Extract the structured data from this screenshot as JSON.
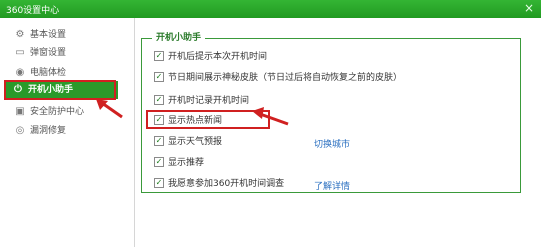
{
  "window": {
    "title": "360设置中心",
    "close_glyph": "×"
  },
  "sidebar": {
    "items": [
      {
        "label": "基本设置",
        "icon": "gear-icon",
        "glyph": "⚙"
      },
      {
        "label": "弹窗设置",
        "icon": "window-icon",
        "glyph": "▭"
      },
      {
        "label": "电脑体检",
        "icon": "checkup-icon",
        "glyph": "◉"
      },
      {
        "label": "开机小助手",
        "icon": "power-icon",
        "glyph": "⏻",
        "active": true
      },
      {
        "label": "安全防护中心",
        "icon": "shield-icon",
        "glyph": "▣"
      },
      {
        "label": "漏洞修复",
        "icon": "patch-icon",
        "glyph": "◎"
      }
    ]
  },
  "panel": {
    "title": "开机小助手",
    "options": [
      {
        "label": "开机后提示本次开机时间",
        "checked": true
      },
      {
        "label": "节日期间展示神秘皮肤（节日过后将自动恢复之前的皮肤）",
        "checked": true
      },
      {
        "label": "开机时记录开机时间",
        "checked": true
      },
      {
        "label": "显示热点新闻",
        "checked": true
      },
      {
        "label": "显示天气预报",
        "checked": true,
        "link": "切换城市"
      },
      {
        "label": "显示推荐",
        "checked": true
      },
      {
        "label": "我愿意参加360开机时间调查",
        "checked": true,
        "link": "了解详情"
      }
    ]
  },
  "colors": {
    "accent_green": "#2a9a2a",
    "highlight_red": "#d02020",
    "link_blue": "#2a6fc0"
  }
}
